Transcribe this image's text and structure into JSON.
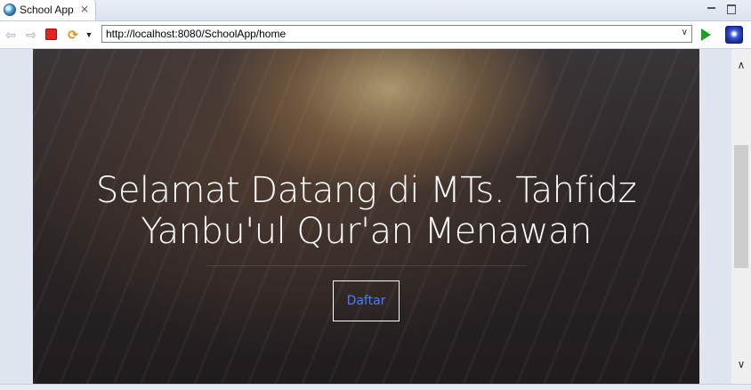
{
  "window": {
    "tab_title": "School App",
    "tab_close_glyph": "⨯"
  },
  "toolbar": {
    "url": "http://localhost:8080/SchoolApp/home",
    "back_icon": "arrow-left-icon",
    "forward_icon": "arrow-right-icon",
    "stop_icon": "stop-icon",
    "refresh_icon": "refresh-icon",
    "go_icon": "play-icon"
  },
  "hero": {
    "title": "Selamat Datang di MTs. Tahfidz Yanbu'ul Qur'an Menawan",
    "button_label": "Daftar"
  },
  "colors": {
    "button_text": "#4a7cff",
    "title_text": "#ffffff",
    "stop_red": "#e02424",
    "go_green": "#1f9d2b"
  }
}
